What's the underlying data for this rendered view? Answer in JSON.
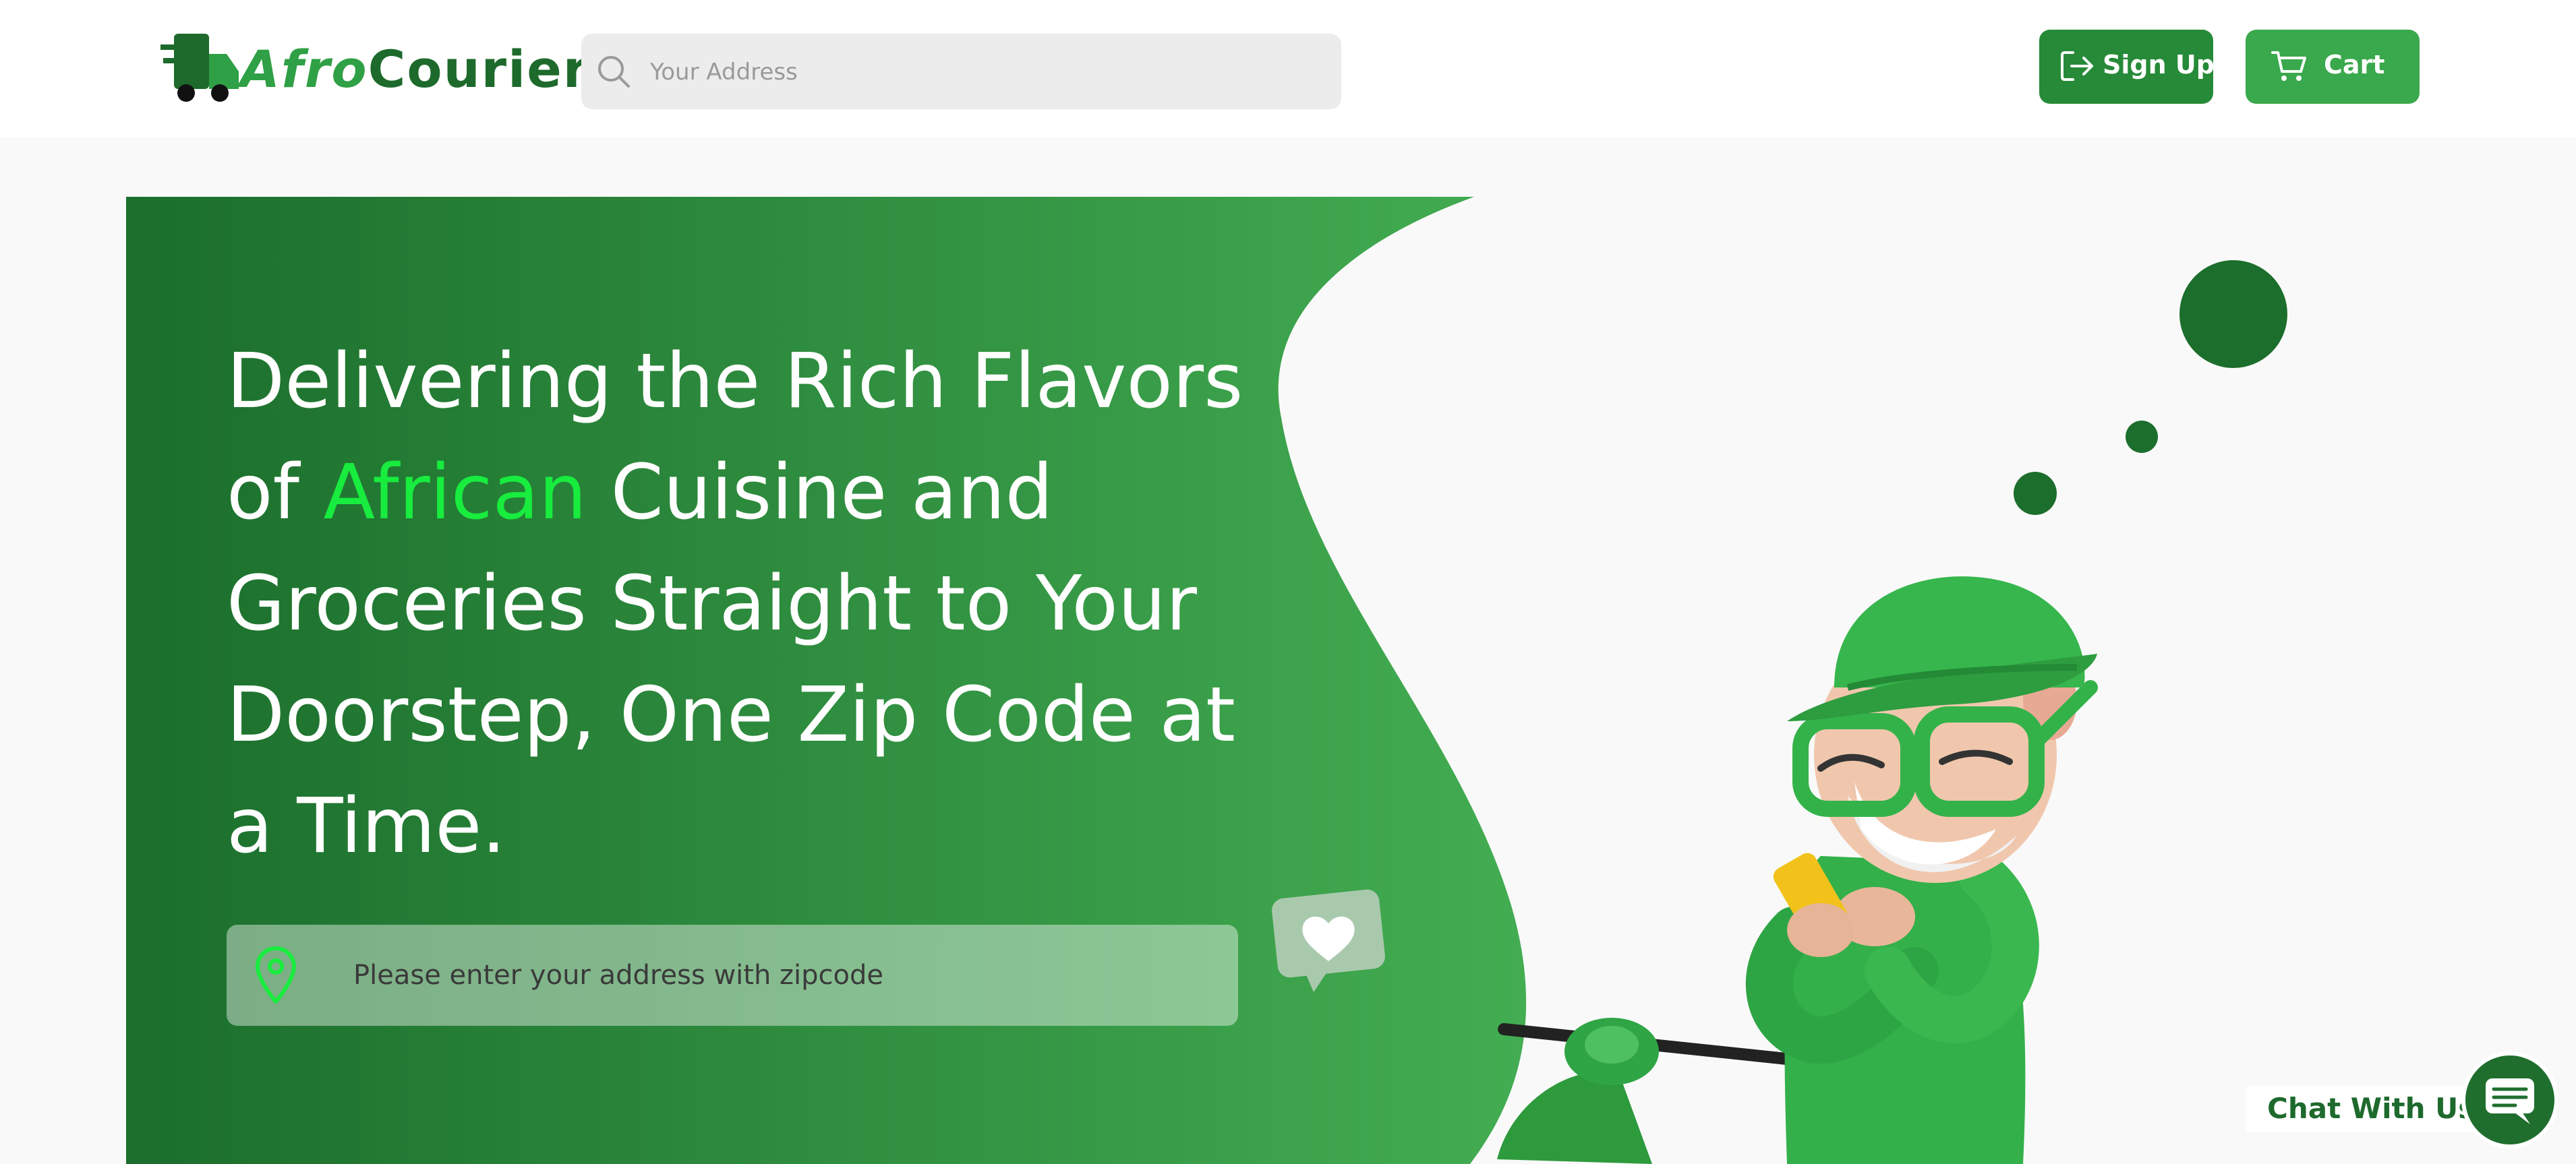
{
  "brand": {
    "name_part1": "Afro",
    "name_part2": "Courier",
    "logo_icon": "delivery-truck-icon",
    "color_dark": "#1d6a2c",
    "color_accent": "#2fa045"
  },
  "header": {
    "search": {
      "icon": "search-icon",
      "placeholder": "Your Address",
      "value": ""
    },
    "signup": {
      "icon": "sign-in-arrow-icon",
      "label": "Sign Up",
      "color": "#268a38"
    },
    "cart": {
      "icon": "cart-icon",
      "label": "Cart",
      "color": "#3aa84c"
    }
  },
  "hero": {
    "title_part1": "Delivering the Rich Flavors of ",
    "title_highlight": "African",
    "title_part2": " Cuisine and Groceries Straight to Your Doorstep, One Zip Code at a Time.",
    "highlight_color": "#18ec3e",
    "gradient": [
      "#1b6e2c",
      "#43ad52"
    ],
    "address": {
      "icon": "location-pin-icon",
      "placeholder": "Please enter your address with zipcode",
      "value": ""
    },
    "illustration": "delivery-courier-character",
    "decor_icon": "heart-chat-bubble-icon"
  },
  "chat": {
    "label": "Chat With Us",
    "icon": "chat-bubble-icon"
  }
}
